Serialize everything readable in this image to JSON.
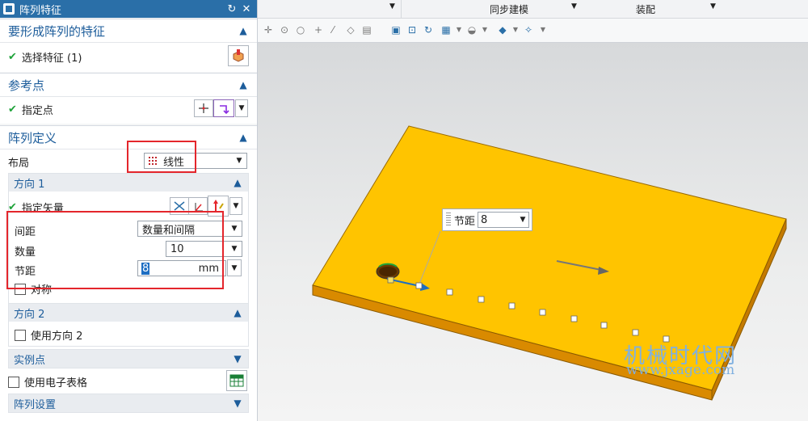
{
  "dialog": {
    "title": "阵列特征",
    "reset_icon": "reset-icon",
    "close_icon": "close-icon"
  },
  "feature_section": {
    "title": "要形成阵列的特征",
    "select_label": "选择特征 (1)"
  },
  "reference_section": {
    "title": "参考点",
    "point_label": "指定点"
  },
  "pattern_section": {
    "title": "阵列定义",
    "layout_label": "布局",
    "layout_value": "线性",
    "direction1": {
      "title": "方向 1",
      "vector_label": "指定矢量",
      "spacing_label": "间距",
      "spacing_value": "数量和间隔",
      "count_label": "数量",
      "count_value": "10",
      "pitch_label": "节距",
      "pitch_value": "8",
      "pitch_unit": "mm",
      "symmetric_label": "对称"
    },
    "direction2": {
      "title": "方向 2",
      "use_label": "使用方向 2"
    },
    "instance_title": "实例点",
    "spreadsheet_label": "使用电子表格",
    "settings_title": "阵列设置"
  },
  "menubar": {
    "sync_modeling": "同步建模",
    "assembly": "装配"
  },
  "viewport": {
    "pitch_label": "节距",
    "pitch_value": "8",
    "watermark_cn": "机械时代网",
    "watermark_url": "www.jxage.com",
    "plate_color": "#ffc400",
    "plate_side_color": "#d98a00"
  },
  "colors": {
    "accent": "#1d5d9b",
    "titlebar": "#2a6fa8",
    "highlight_box": "#e4262c",
    "check": "#1fa33a"
  }
}
